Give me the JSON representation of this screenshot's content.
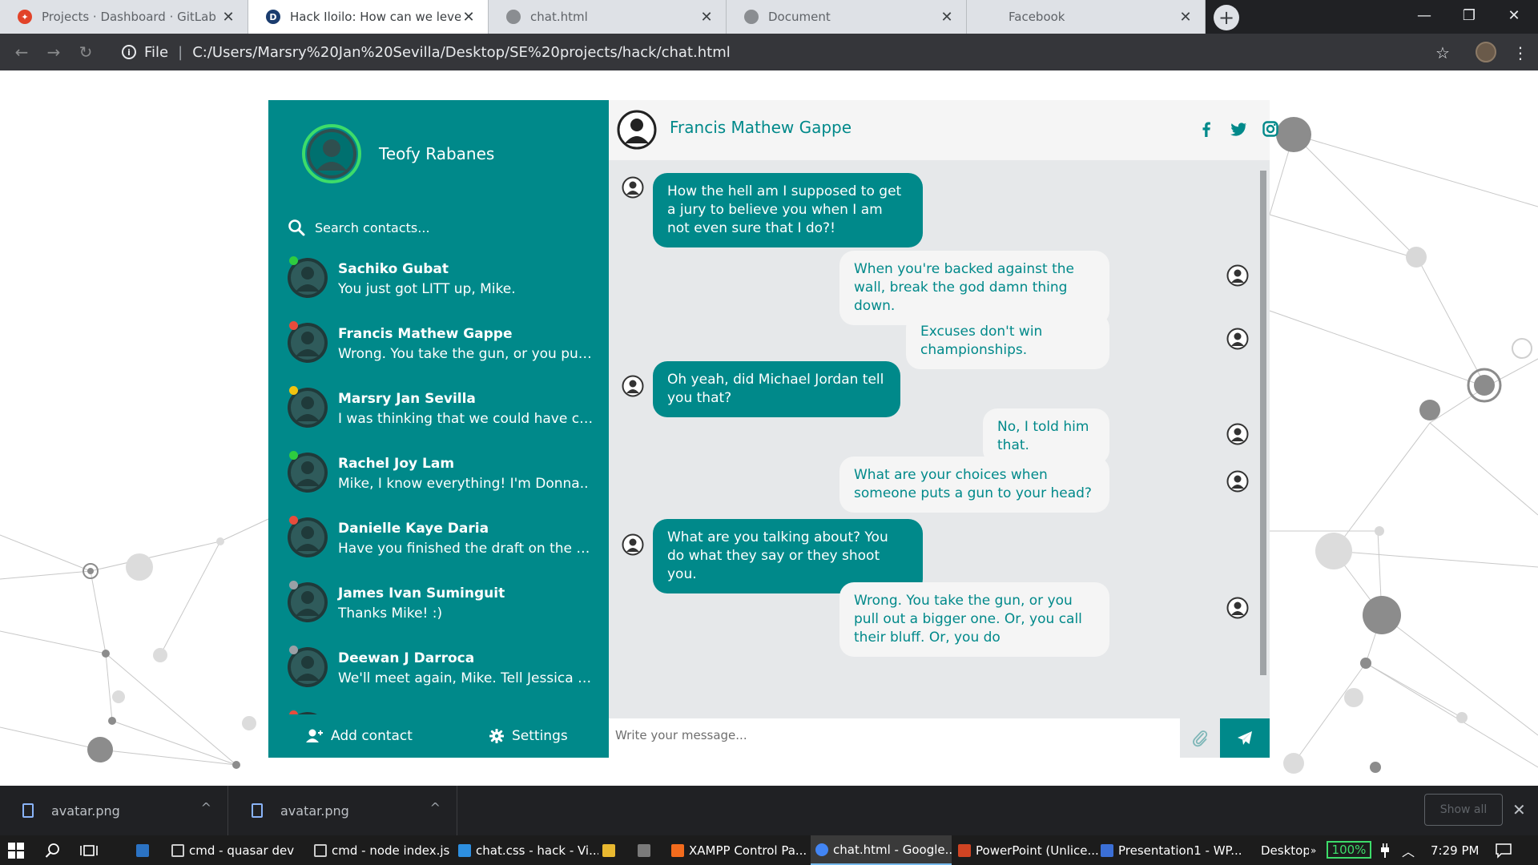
{
  "browser": {
    "tabs": [
      {
        "title": "Projects · Dashboard · GitLab",
        "favicon": "gitlab-icon",
        "active": false
      },
      {
        "title": "Hack Iloilo: How can we leverage",
        "favicon": "d-icon",
        "active": true
      },
      {
        "title": "chat.html",
        "favicon": "globe-icon",
        "active": false
      },
      {
        "title": "Document",
        "favicon": "globe-icon",
        "active": false
      },
      {
        "title": "Facebook",
        "favicon": "facebook-icon",
        "active": false
      }
    ],
    "address": {
      "scheme_label": "File",
      "url": "C:/Users/Marsry%20Jan%20Sevilla/Desktop/SE%20projects/hack/chat.html"
    }
  },
  "sidebar": {
    "user_name": "Teofy Rabanes",
    "search_placeholder": "Search contacts...",
    "contacts": [
      {
        "name": "Sachiko Gubat",
        "preview": "You just got LITT up, Mike.",
        "status": "#2ecc40"
      },
      {
        "name": "Francis Mathew Gappe",
        "preview": "Wrong. You take the gun, or you pull out a bigger one.",
        "status": "#e74c3c"
      },
      {
        "name": "Marsry Jan Sevilla",
        "preview": "I was thinking that we could have chicken tonight.",
        "status": "#f1c40f"
      },
      {
        "name": "Rachel Joy Lam",
        "preview": "Mike, I know everything! I'm Donna..",
        "status": "#2ecc40"
      },
      {
        "name": "Danielle Kaye Daria",
        "preview": "Have you finished the draft on the Hinsenburg deal?",
        "status": "#e74c3c"
      },
      {
        "name": "James Ivan Suminguit",
        "preview": "Thanks Mike! :)",
        "status": "#9aa0a6"
      },
      {
        "name": "Deewan J Darroca",
        "preview": "We'll meet again, Mike. Tell Jessica I said hi.",
        "status": "#9aa0a6"
      },
      {
        "name": "",
        "preview": "",
        "status": "#e74c3c"
      }
    ],
    "footer": {
      "add_contact": "Add contact",
      "settings": "Settings"
    }
  },
  "chat": {
    "contact_name": "Francis Mathew Gappe",
    "social": [
      "facebook-icon",
      "twitter-icon",
      "instagram-icon"
    ],
    "messages": [
      {
        "direction": "in",
        "text": "How the hell am I supposed to get a jury to believe you when I am not even sure that I do?!"
      },
      {
        "direction": "out",
        "text": "When you're backed against the wall, break the god damn thing down."
      },
      {
        "direction": "out",
        "text": "Excuses don't win championships."
      },
      {
        "direction": "in",
        "text": "Oh yeah, did Michael Jordan tell you that?"
      },
      {
        "direction": "out",
        "text": "No, I told him that."
      },
      {
        "direction": "out",
        "text": "What are your choices when someone puts a gun to your head?"
      },
      {
        "direction": "in",
        "text": "What are you talking about? You do what they say or they shoot you."
      },
      {
        "direction": "out",
        "text": "Wrong. You take the gun, or you pull out a bigger one. Or, you call their bluff. Or, you do"
      }
    ],
    "composer_placeholder": "Write your message..."
  },
  "downloads": {
    "items": [
      "avatar.png",
      "avatar.png"
    ],
    "show_all": "Show all"
  },
  "taskbar": {
    "items": [
      "cmd - quasar  dev",
      "cmd - node  index.js",
      "chat.css - hack - Vi...",
      "XAMPP Control Pa...",
      "chat.html - Google...",
      "PowerPoint (Unlice...",
      "Presentation1 - WP..."
    ],
    "desktop_label": "Desktop",
    "battery": "100%",
    "clock": "7:29 PM"
  },
  "colors": {
    "teal": "#00898a",
    "online": "#2ecc40",
    "busy": "#e74c3c",
    "away": "#f1c40f"
  }
}
